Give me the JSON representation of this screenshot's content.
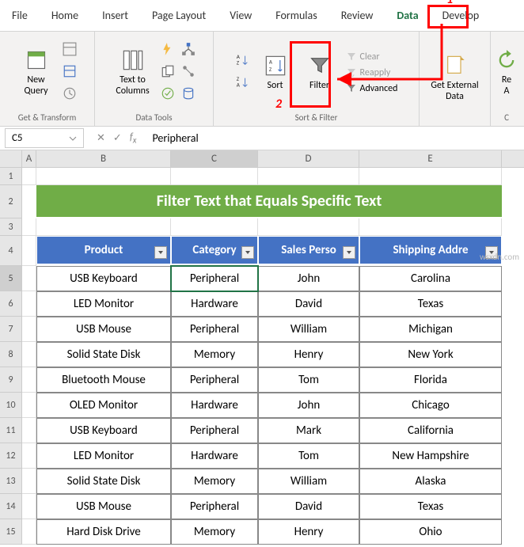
{
  "tabs": [
    "File",
    "Home",
    "Insert",
    "Page Layout",
    "View",
    "Formulas",
    "Review",
    "Data",
    "Develop"
  ],
  "activeTab": "Data",
  "ribbon": {
    "group1": {
      "newQuery": "New\nQuery",
      "label": "Get & Transform"
    },
    "group2": {
      "textToCols": "Text to\nColumns",
      "label": "Data Tools"
    },
    "group3": {
      "sort": "Sort",
      "filter": "Filter",
      "clear": "Clear",
      "reapply": "Reapply",
      "advanced": "Advanced",
      "label": "Sort & Filter"
    },
    "group4": {
      "getExternal": "Get External\nData",
      "label": ""
    },
    "group5": {
      "refresh": "Re\nA"
    }
  },
  "namebox": "C5",
  "formula": "Peripheral",
  "colHeaders": [
    "A",
    "B",
    "C",
    "D",
    "E"
  ],
  "bannerTitle": "Filter Text that Equals Specific Text",
  "tableHeaders": [
    "Product",
    "Category",
    "Sales Perso",
    "Shipping Addre"
  ],
  "rows": [
    {
      "n": 5,
      "b": "USB Keyboard",
      "c": "Peripheral",
      "d": "John",
      "e": "Carolina"
    },
    {
      "n": 6,
      "b": "LED Monitor",
      "c": "Hardware",
      "d": "David",
      "e": "Texas"
    },
    {
      "n": 7,
      "b": "USB Mouse",
      "c": "Peripheral",
      "d": "William",
      "e": "Michigan"
    },
    {
      "n": 8,
      "b": "Solid State Disk",
      "c": "Memory",
      "d": "Henry",
      "e": "New York"
    },
    {
      "n": 9,
      "b": "Bluetooth Mouse",
      "c": "Peripheral",
      "d": "Tom",
      "e": "Florida"
    },
    {
      "n": 10,
      "b": "OLED Monitor",
      "c": "Hardware",
      "d": "John",
      "e": "Chicago"
    },
    {
      "n": 11,
      "b": "USB Keyboard",
      "c": "Peripheral",
      "d": "Mark",
      "e": "California"
    },
    {
      "n": 12,
      "b": "LED Monitor",
      "c": "Hardware",
      "d": "Tom",
      "e": "New Hampshire"
    },
    {
      "n": 13,
      "b": "Solid State Disk",
      "c": "Memory",
      "d": "William",
      "e": "Alaska"
    },
    {
      "n": 14,
      "b": "USB Mouse",
      "c": "Peripheral",
      "d": "David",
      "e": "Texas"
    },
    {
      "n": 15,
      "b": "Hard Disk Drive",
      "c": "Memory",
      "d": "Henry",
      "e": "Ohio"
    }
  ],
  "annotations": {
    "label1": "1",
    "label2": "2"
  },
  "watermark": "wsxdn.com"
}
